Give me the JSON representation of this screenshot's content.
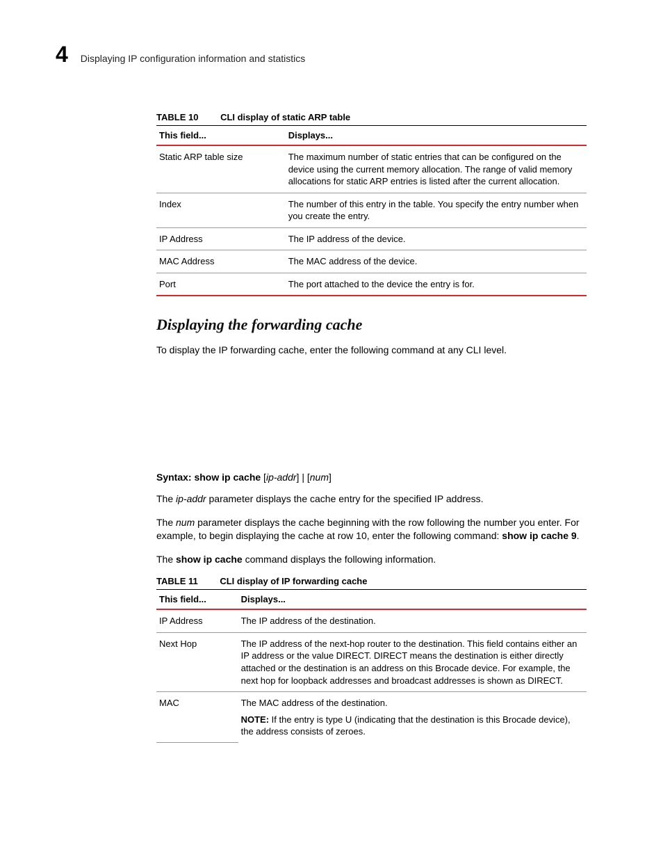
{
  "header": {
    "chapter_number": "4",
    "title": "Displaying IP configuration information and statistics"
  },
  "table10": {
    "label": "TABLE 10",
    "title": "CLI display of static ARP table",
    "head_field": "This field...",
    "head_displays": "Displays...",
    "rows": [
      {
        "f": "Static ARP table size",
        "d": "The maximum number of static entries that can be configured on the device using the current memory allocation. The range of valid memory allocations for static ARP entries is listed after the current allocation."
      },
      {
        "f": "Index",
        "d": "The number of this entry in the table. You specify the entry number when you create the entry."
      },
      {
        "f": "IP Address",
        "d": "The IP address of the device."
      },
      {
        "f": "MAC Address",
        "d": "The MAC address of the device."
      },
      {
        "f": "Port",
        "d": "The port attached to the device the entry is for."
      }
    ]
  },
  "section2": {
    "heading": "Displaying the forwarding cache",
    "intro": "To display the IP forwarding cache, enter the following command at any CLI level."
  },
  "syntax": {
    "prefix": "Syntax:  ",
    "cmd": "show ip cache",
    "open1": " [",
    "arg1": "ip-addr",
    "mid": "]  |  [",
    "arg2": "num",
    "close2": "]"
  },
  "para_ipaddr_1": "The ",
  "para_ipaddr_em": "ip-addr",
  "para_ipaddr_2": " parameter displays the cache entry for the specified IP address.",
  "para_num_1": "The ",
  "para_num_em": "num",
  "para_num_2": " parameter displays the cache beginning with the row following the number you enter. For example, to begin displaying the cache at row 10, enter the following command: ",
  "para_num_cmd": "show ip cache 9",
  "para_num_3": ".",
  "para_showip_1": "The ",
  "para_showip_cmd": "show ip cache",
  "para_showip_2": " command displays the following information.",
  "table11": {
    "label": "TABLE 11",
    "title": "CLI display of IP forwarding cache",
    "head_field": "This field...",
    "head_displays": "Displays...",
    "rows": [
      {
        "f": "IP Address",
        "d": "The IP address of the destination."
      },
      {
        "f": "Next Hop",
        "d": "The IP address of the next-hop router to the destination. This field contains either an IP address or the value DIRECT. DIRECT means the destination is either directly attached or the destination is an address on this Brocade device. For example, the next hop for loopback addresses and broadcast addresses is shown as DIRECT."
      }
    ],
    "mac_row": {
      "f": "MAC",
      "d_main": "The MAC address of the destination.",
      "note_label": "NOTE:  ",
      "note_text": "If the entry is type U (indicating that the destination is this Brocade device), the address consists of zeroes."
    }
  }
}
